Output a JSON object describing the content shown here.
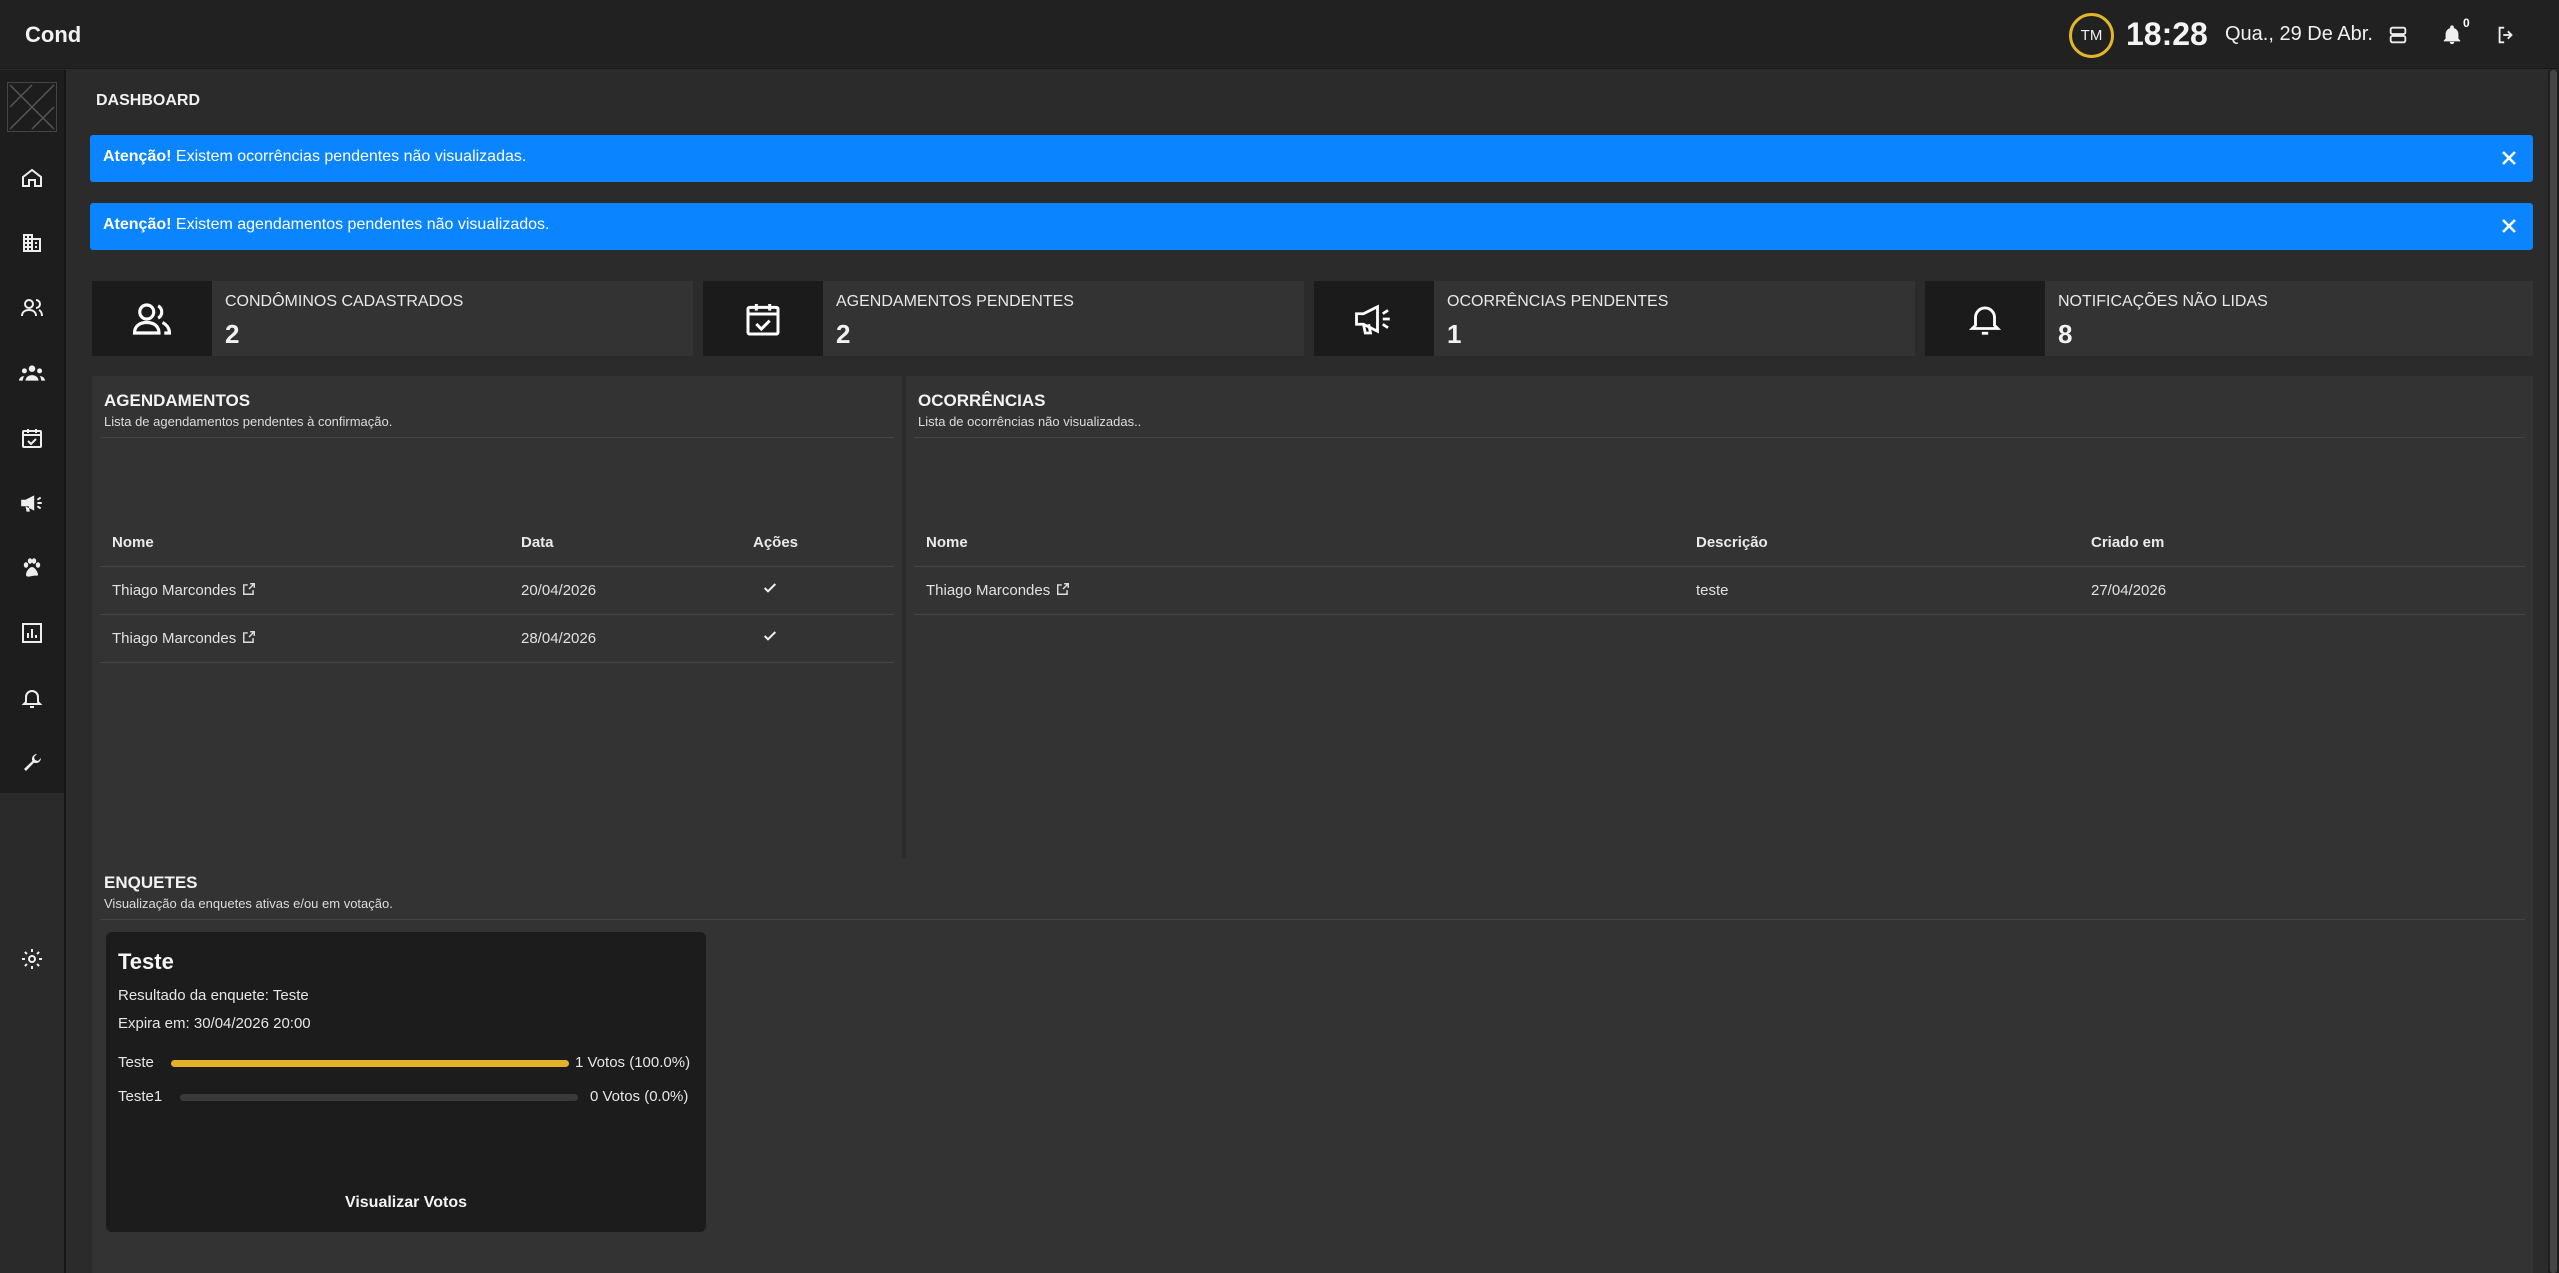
{
  "app": {
    "brand": "Cond"
  },
  "topbar": {
    "avatar_initials": "TM",
    "time": "18:28",
    "date": "Qua., 29 De Abr.",
    "notification_count": "0"
  },
  "page": {
    "title": "DASHBOARD"
  },
  "alerts": [
    {
      "strong": "Atenção!",
      "text": " Existem ocorrências pendentes não visualizadas."
    },
    {
      "strong": "Atenção!",
      "text": " Existem agendamentos pendentes não visualizados."
    }
  ],
  "stats": [
    {
      "label": "CONDÔMINOS CADASTRADOS",
      "value": "2",
      "icon": "users-icon"
    },
    {
      "label": "AGENDAMENTOS PENDENTES",
      "value": "2",
      "icon": "calendar-check-icon"
    },
    {
      "label": "OCORRÊNCIAS PENDENTES",
      "value": "1",
      "icon": "megaphone-icon"
    },
    {
      "label": "NOTIFICAÇÕES NÃO LIDAS",
      "value": "8",
      "icon": "bell-icon"
    }
  ],
  "agendamentos": {
    "title": "AGENDAMENTOS",
    "subtitle": "Lista de agendamentos pendentes à confirmação.",
    "columns": [
      "Nome",
      "Data",
      "Ações"
    ],
    "rows": [
      {
        "nome": "Thiago Marcondes",
        "data": "20/04/2026"
      },
      {
        "nome": "Thiago Marcondes",
        "data": "28/04/2026"
      }
    ]
  },
  "ocorrencias": {
    "title": "OCORRÊNCIAS",
    "subtitle": "Lista de ocorrências não visualizadas..",
    "columns": [
      "Nome",
      "Descrição",
      "Criado em"
    ],
    "rows": [
      {
        "nome": "Thiago Marcondes",
        "descricao": "teste",
        "criado": "27/04/2026"
      }
    ]
  },
  "enquetes": {
    "title": "ENQUETES",
    "subtitle": "Visualização da enquetes ativas e/ou em votação.",
    "poll": {
      "title": "Teste",
      "result": "Resultado da enquete: Teste",
      "expires": "Expira em: 30/04/2026 20:00",
      "options": [
        {
          "name": "Teste",
          "votes": "1 Votos (100.0%)",
          "fraction": 1.0
        },
        {
          "name": "Teste1",
          "votes": "0 Votos (0.0%)",
          "fraction": 0.0
        }
      ],
      "action": "Visualizar Votos"
    }
  },
  "sidebar": {
    "items": [
      "home-icon",
      "building-icon",
      "user-group-icon",
      "team-icon",
      "calendar-icon",
      "megaphone-icon",
      "paw-icon",
      "chart-icon",
      "bell-icon",
      "wrench-icon"
    ],
    "footer_icon": "gear-icon"
  },
  "colors": {
    "accent": "#0a84ff",
    "poll_bar": "#e3b22a",
    "avatar_ring": "#e2b52a"
  }
}
